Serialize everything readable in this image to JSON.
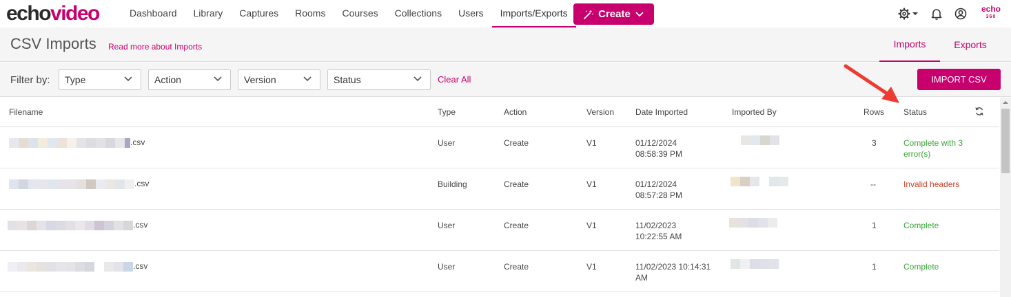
{
  "brand": {
    "echo": "echo",
    "video": "video",
    "corner_logo_top": "echo",
    "corner_logo_bottom": "360"
  },
  "nav": {
    "items": [
      "Dashboard",
      "Library",
      "Captures",
      "Rooms",
      "Courses",
      "Collections",
      "Users",
      "Imports/Exports"
    ],
    "active": "Imports/Exports",
    "create_label": "Create"
  },
  "icons": {
    "settings": "gear-icon",
    "notifications": "bell-icon",
    "account": "user-circle-icon",
    "create": "magic-wand-icon"
  },
  "header": {
    "title": "CSV Imports",
    "read_more": "Read more about Imports",
    "tabs": [
      {
        "label": "Imports",
        "active": true
      },
      {
        "label": "Exports",
        "active": false
      }
    ]
  },
  "filters": {
    "label": "Filter by:",
    "selects": [
      {
        "value": "Type"
      },
      {
        "value": "Action"
      },
      {
        "value": "Version"
      },
      {
        "value": "Status"
      }
    ],
    "clear_all": "Clear All",
    "import_button": "IMPORT CSV"
  },
  "table": {
    "columns": [
      "Filename",
      "Type",
      "Action",
      "Version",
      "Date Imported",
      "Imported By",
      "Rows",
      "Status"
    ],
    "rows": [
      {
        "filename_suffix": ".csv",
        "type": "User",
        "action": "Create",
        "version": "V1",
        "date_line1": "01/12/2024",
        "date_line2": "08:58:39 PM",
        "rows": "3",
        "status_line1": "Complete with 3",
        "status_line2": "error(s)",
        "status_kind": "ok"
      },
      {
        "filename_suffix": ".csv",
        "type": "Building",
        "action": "Create",
        "version": "V1",
        "date_line1": "01/12/2024",
        "date_line2": "08:57:28 PM",
        "rows": "--",
        "status_line1": "Invalid headers",
        "status_line2": "",
        "status_kind": "bad"
      },
      {
        "filename_suffix": ".csv",
        "type": "User",
        "action": "Create",
        "version": "V1",
        "date_line1": "11/02/2023",
        "date_line2": "10:22:55 AM",
        "rows": "1",
        "status_line1": "Complete",
        "status_line2": "",
        "status_kind": "ok"
      },
      {
        "filename_suffix": ".csv",
        "type": "User",
        "action": "Create",
        "version": "V1",
        "date_line1": "11/02/2023 10:14:31",
        "date_line2": "AM",
        "rows": "1",
        "status_line1": "Complete",
        "status_line2": "",
        "status_kind": "ok"
      }
    ]
  },
  "colors": {
    "accent": "#c8006e",
    "status_ok": "#3aa53a",
    "status_bad": "#c8432a",
    "annotation": "#ee3b32"
  }
}
